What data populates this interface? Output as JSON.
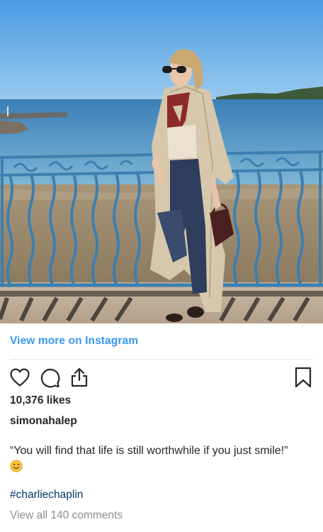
{
  "post": {
    "image_alt": "Woman in trench coat posing by seaside railing",
    "view_more_label": "View more on Instagram",
    "likes_text": "10,376 likes",
    "username": "simonahalep",
    "caption_text": "“You will find that life is still worthwhile if you just smile!”",
    "caption_emoji": "smiling-face-emoji",
    "hashtag": "#charliechaplin",
    "comments_link": "View all 140 comments"
  },
  "icons": {
    "like": "heart-icon",
    "comment": "comment-bubble-icon",
    "share": "share-upload-icon",
    "save": "bookmark-icon"
  },
  "colors": {
    "link_blue": "#3897f0",
    "text": "#262626",
    "muted": "#8e8e8e",
    "hashtag": "#00376b",
    "railing": "#3d7fb0"
  }
}
